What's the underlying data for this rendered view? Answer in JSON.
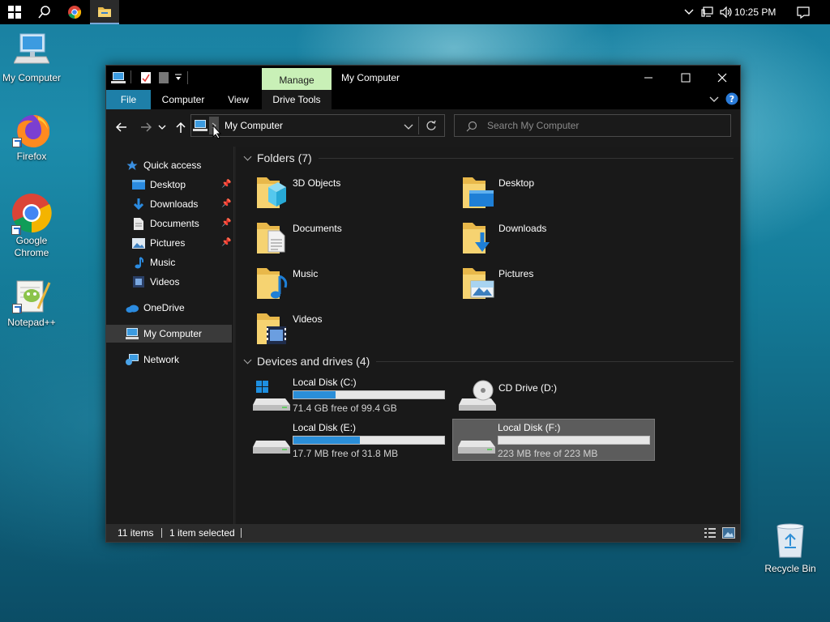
{
  "taskbar": {
    "clock": "10:25 PM"
  },
  "desktop": {
    "icons": [
      {
        "label": "My Computer"
      },
      {
        "label": "Firefox"
      },
      {
        "label": "Google Chrome"
      },
      {
        "label": "Notepad++"
      },
      {
        "label": "Recycle Bin"
      }
    ]
  },
  "window": {
    "title": "My Computer",
    "manage_tab": "Manage",
    "ribbon_tabs": [
      "File",
      "Computer",
      "View",
      "Drive Tools"
    ],
    "address": "My Computer",
    "search_placeholder": "Search My Computer",
    "nav": {
      "quick_access": "Quick access",
      "quick_items": [
        {
          "label": "Desktop",
          "pinned": true
        },
        {
          "label": "Downloads",
          "pinned": true
        },
        {
          "label": "Documents",
          "pinned": true
        },
        {
          "label": "Pictures",
          "pinned": true
        },
        {
          "label": "Music",
          "pinned": false
        },
        {
          "label": "Videos",
          "pinned": false
        }
      ],
      "onedrive": "OneDrive",
      "my_computer": "My Computer",
      "network": "Network"
    },
    "folders_header": "Folders (7)",
    "folders": [
      "3D Objects",
      "Desktop",
      "Documents",
      "Downloads",
      "Music",
      "Pictures",
      "Videos"
    ],
    "drives_header": "Devices and drives (4)",
    "drives": [
      {
        "name": "Local Disk (C:)",
        "free": "71.4 GB free of 99.4 GB",
        "used_fraction": 0.28
      },
      {
        "name": "CD Drive (D:)"
      },
      {
        "name": "Local Disk (E:)",
        "free": "17.7 MB free of 31.8 MB",
        "used_fraction": 0.44
      },
      {
        "name": "Local Disk (F:)",
        "free": "223 MB free of 223 MB",
        "used_fraction": 0.0
      }
    ],
    "status": {
      "items": "11 items",
      "selected": "1 item selected"
    }
  },
  "colors": {
    "accent": "#1e7fa8",
    "manage_tab": "#c9f0b7",
    "progress": "#2a8ed8"
  }
}
